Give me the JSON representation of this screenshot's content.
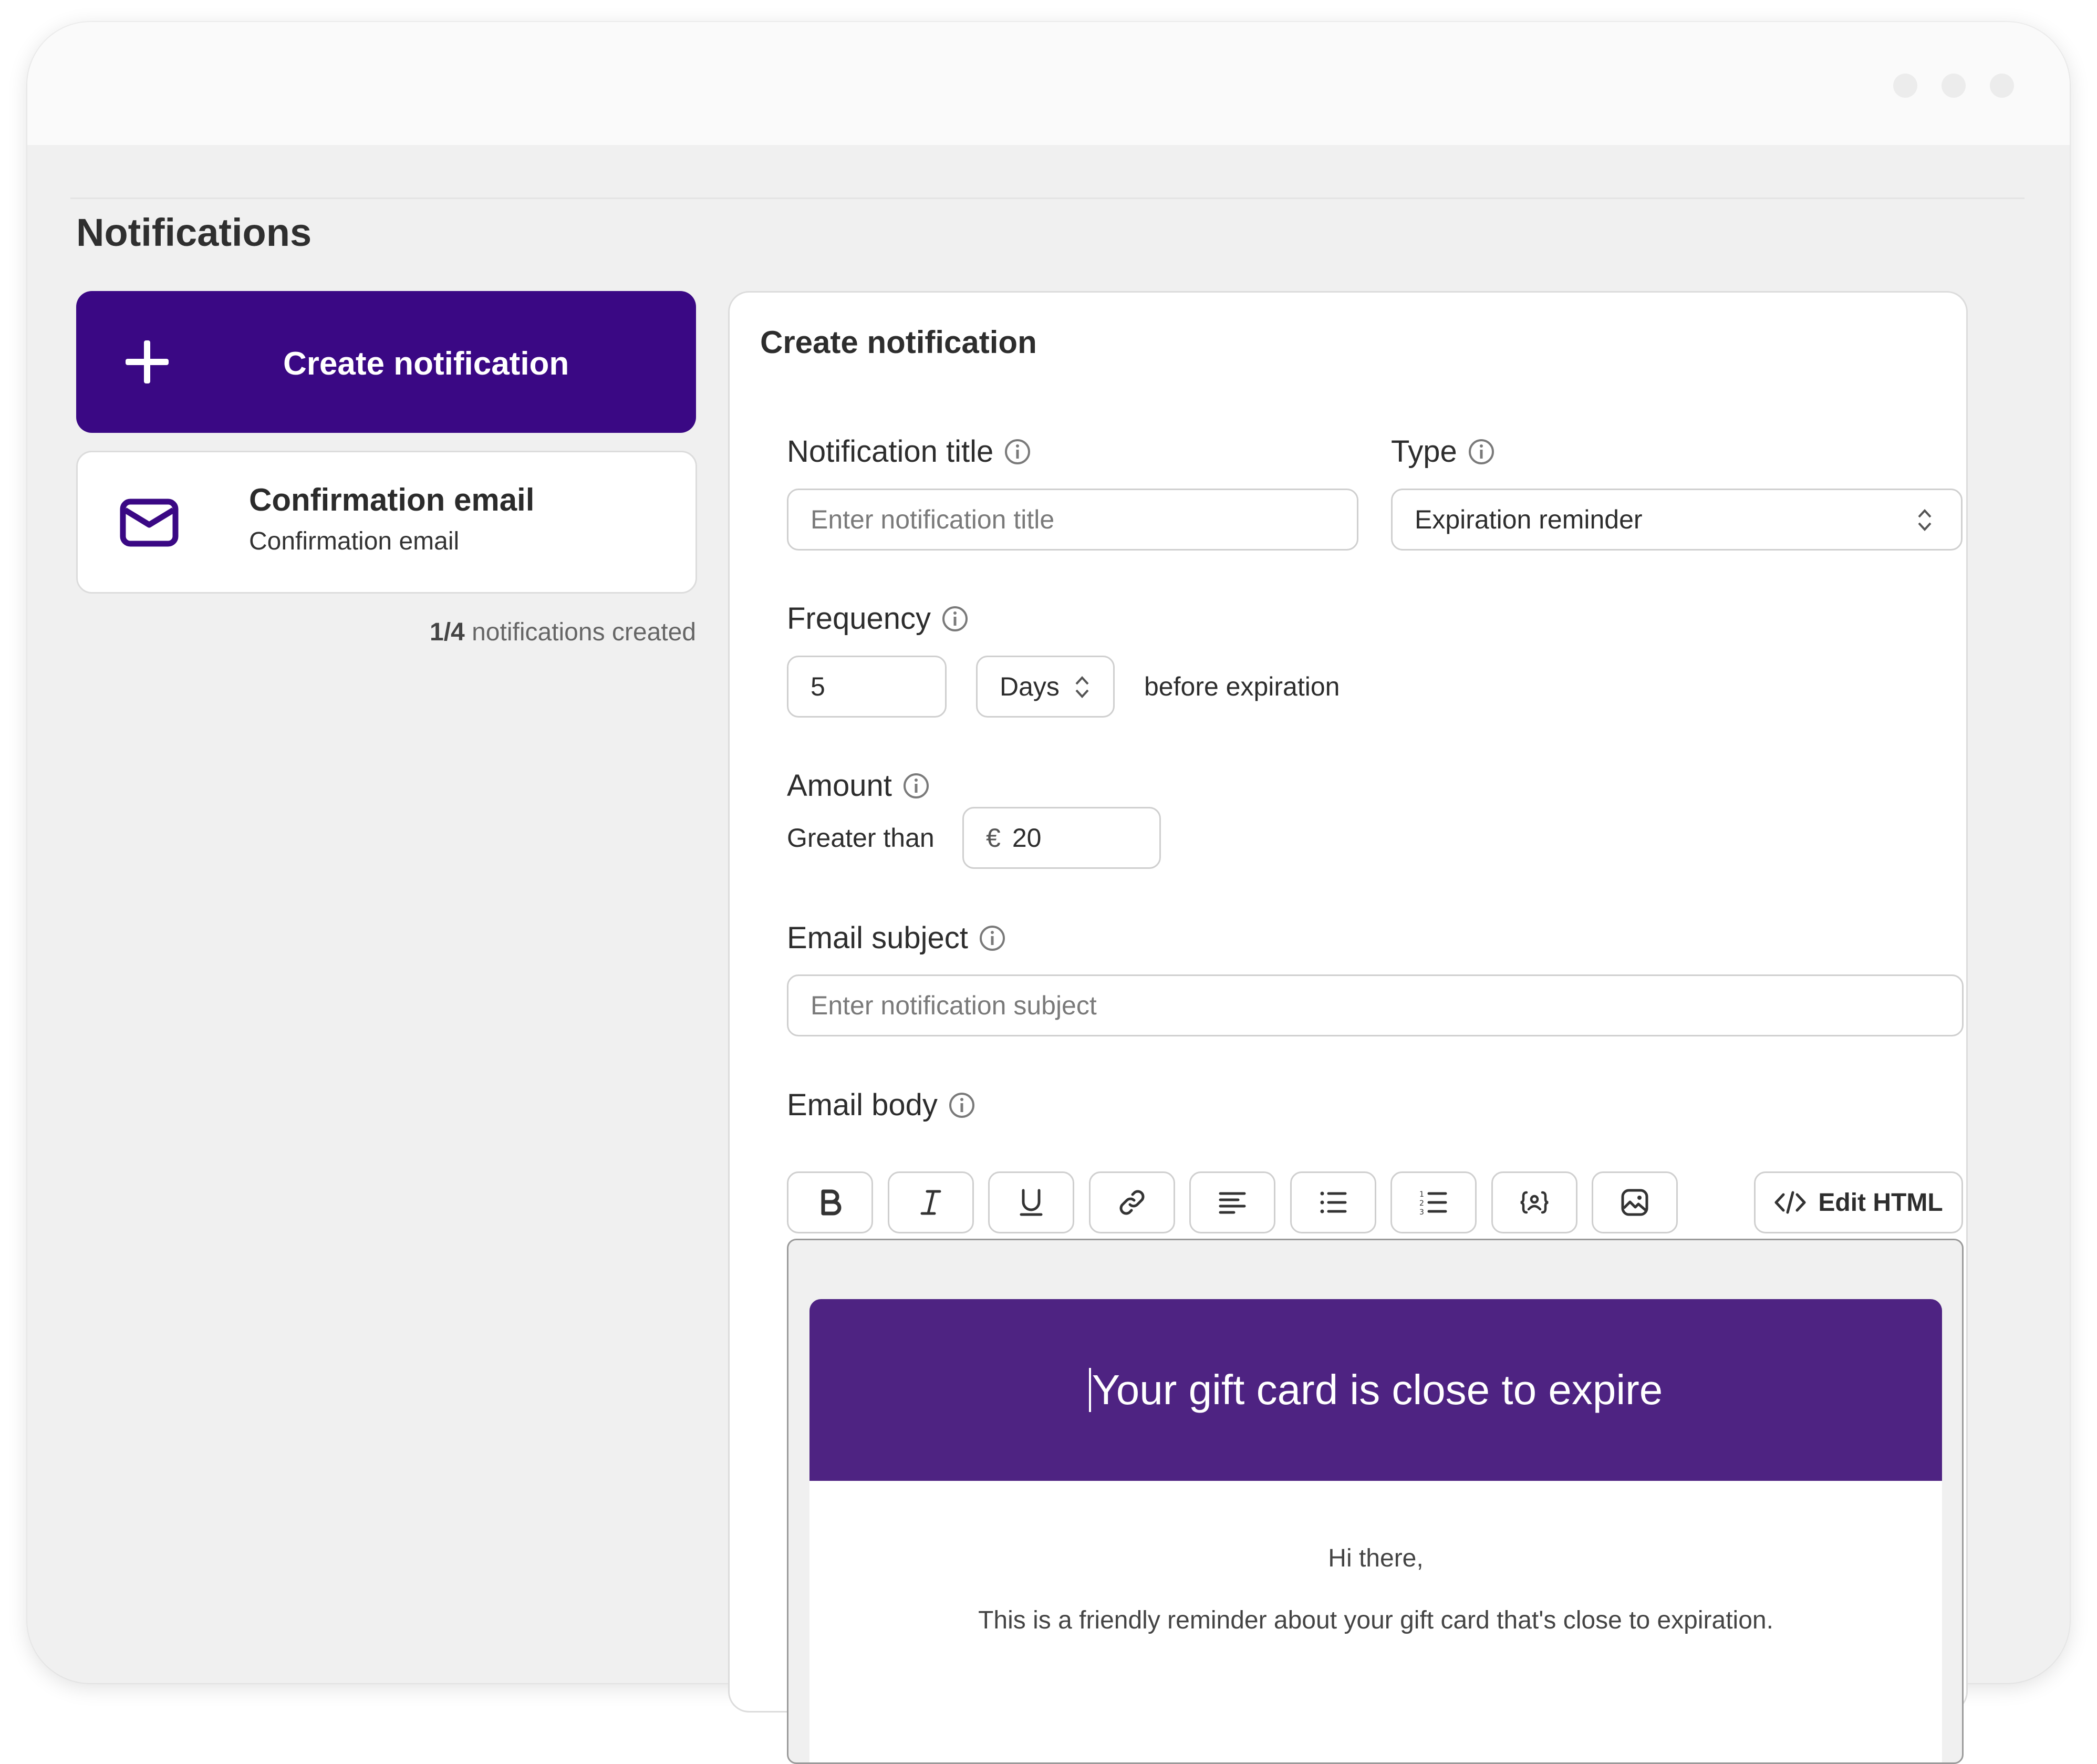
{
  "page": {
    "title": "Notifications"
  },
  "sidebar": {
    "create_button": "Create notification",
    "items": [
      {
        "title": "Confirmation email",
        "subtitle": "Confirmation email",
        "icon": "mail-icon"
      }
    ],
    "count_current": "1/4",
    "count_suffix": " notifications created"
  },
  "form": {
    "heading": "Create notification",
    "title_label": "Notification title",
    "title_placeholder": "Enter notification title",
    "title_value": "",
    "type_label": "Type",
    "type_value": "Expiration reminder",
    "frequency_label": "Frequency",
    "frequency_value": "5",
    "frequency_unit": "Days",
    "frequency_suffix": "before expiration",
    "amount_label": "Amount",
    "amount_condition": "Greater than",
    "amount_currency": "€",
    "amount_value": "20",
    "subject_label": "Email subject",
    "subject_placeholder": "Enter notification subject",
    "subject_value": "",
    "body_label": "Email body",
    "toolbar": {
      "buttons": [
        "bold-icon",
        "italic-icon",
        "underline-icon",
        "link-icon",
        "align-left-icon",
        "bullet-list-icon",
        "numbered-list-icon",
        "variable-icon",
        "image-icon"
      ],
      "edit_html": "Edit HTML"
    },
    "preview": {
      "header": "Your gift card is close to expire",
      "greeting": "Hi there,",
      "message": "This is a friendly reminder about your gift card that's close to expiration."
    }
  },
  "colors": {
    "brand": "#3a0884",
    "email_header": "#4e2382",
    "background": "#f0f0f0"
  }
}
